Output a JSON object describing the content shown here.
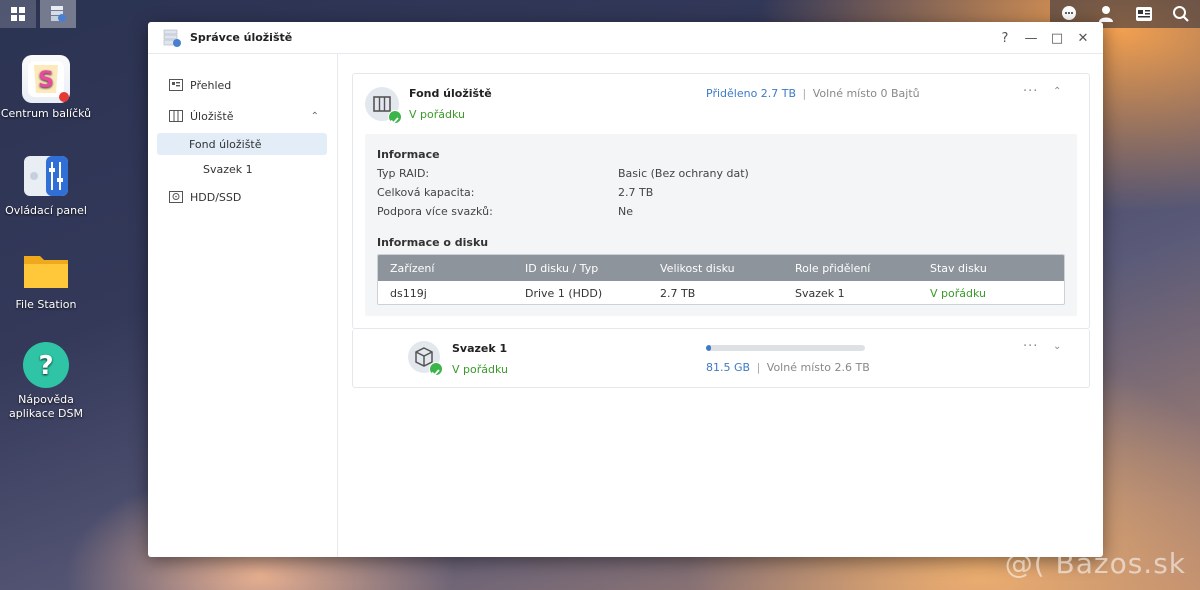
{
  "taskbar": {
    "left_buttons": [
      "main-menu-icon",
      "storage-manager-icon"
    ],
    "right_icons": [
      "chat-icon",
      "user-icon",
      "widgets-icon",
      "search-icon"
    ]
  },
  "desktop": {
    "icons": [
      {
        "label": "Centrum balíčků",
        "icon": "package-center-icon"
      },
      {
        "label": "Ovládací panel",
        "icon": "control-panel-icon"
      },
      {
        "label": "File Station",
        "icon": "folder-icon"
      },
      {
        "label": "Nápověda aplikace DSM",
        "icon": "help-icon"
      }
    ]
  },
  "window": {
    "title": "Správce úložiště",
    "controls": {
      "help": "?",
      "minimize": "—",
      "maximize": "□",
      "close": "✕"
    }
  },
  "sidebar": {
    "items": [
      {
        "label": "Přehled"
      },
      {
        "label": "Úložiště"
      },
      {
        "label": "Fond úložiště"
      },
      {
        "label": "Svazek 1"
      },
      {
        "label": "HDD/SSD"
      }
    ]
  },
  "pool": {
    "title": "Fond úložiště",
    "status": "V pořádku",
    "allocated": "Přiděleno 2.7 TB",
    "separator": "|",
    "free": "Volné místo 0 Bajtů",
    "more": "···",
    "info": {
      "heading": "Informace",
      "rows": [
        {
          "label": "Typ RAID:",
          "value": "Basic (Bez ochrany dat)"
        },
        {
          "label": "Celková kapacita:",
          "value": "2.7 TB"
        },
        {
          "label": "Podpora více svazků:",
          "value": "Ne"
        }
      ]
    },
    "disk_info": {
      "heading": "Informace o disku",
      "columns": [
        "Zařízení",
        "ID disku / Typ",
        "Velikost disku",
        "Role přidělení",
        "Stav disku"
      ],
      "rows": [
        [
          "ds119j",
          "Drive 1 (HDD)",
          "2.7 TB",
          "Svazek 1",
          "V pořádku"
        ]
      ]
    }
  },
  "volume": {
    "title": "Svazek 1",
    "status": "V pořádku",
    "used": "81.5 GB",
    "separator": "|",
    "free": "Volné místo 2.6 TB",
    "usage_fraction": 0.03,
    "more": "···"
  },
  "watermark": "@( Bazos.sk",
  "colors": {
    "accent": "#3d7ac6",
    "ok": "#3a9a2a",
    "table_header": "#8d949c"
  }
}
